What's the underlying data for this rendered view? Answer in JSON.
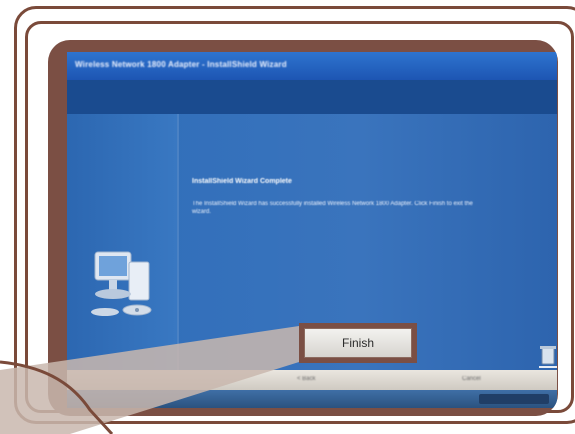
{
  "window": {
    "title": "Wireless Network 1800 Adapter - InstallShield Wizard"
  },
  "wizard": {
    "heading": "InstallShield Wizard Complete",
    "message": "The InstallShield Wizard has successfully installed Wireless Network 1800 Adapter. Click Finish to exit the wizard."
  },
  "buttons": {
    "finish_label": "Finish",
    "back_label": "< Back",
    "cancel_label": "Cancel"
  },
  "icons": {
    "computer": "computer-setup-icon",
    "desktop": "recycle-bin-icon",
    "tray": "system-tray-icon"
  },
  "colors": {
    "frame": "#7b4f44",
    "wizard_blue": "#2f69b5",
    "title_blue": "#1d55b3"
  }
}
